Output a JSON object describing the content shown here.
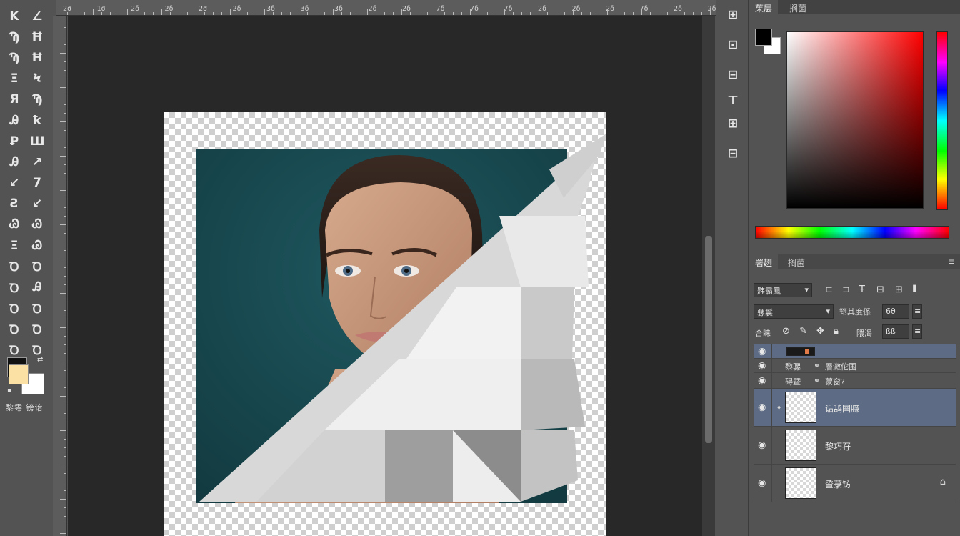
{
  "toolbox": {
    "tools": [
      "K",
      "∠",
      "Ϡ",
      "Ħ",
      "Ϡ",
      "Ħ",
      "Ξ",
      "Ϟ",
      "Я",
      "Ϡ",
      "Ꭿ",
      "ꝁ",
      "Ꝑ",
      "Ш",
      "Ꭿ",
      "↗",
      "↙",
      "7",
      "Ƨ",
      "↙",
      "Ꮚ",
      "Ꮚ",
      "Ξ",
      "Ꮚ",
      "Ꝺ",
      "Ꝺ",
      "Ꝺ",
      "Ꭿ",
      "Ꝺ",
      "Ꝺ",
      "Ꝺ",
      "Ꝺ",
      "Ꝺ",
      "Ꝺ"
    ],
    "footer": "黎雩 镑诒"
  },
  "ruler": {
    "top_labels": [
      "2σ",
      "1σ",
      "2δ",
      "2δ",
      "2σ",
      "2δ",
      "3δ",
      "3δ",
      "3δ",
      "2δ",
      "2δ",
      "7δ",
      "7δ",
      "7δ",
      "2δ",
      "2δ",
      "2δ",
      "7δ",
      "2δ",
      "2δ",
      "2δ"
    ]
  },
  "side_strip": {
    "icons": [
      "⊞",
      "⊡",
      "⊟",
      "⊤",
      "⊞",
      "⊟"
    ]
  },
  "color_panel": {
    "tabs": [
      "茱层",
      "搁菌"
    ],
    "fg_color": "#000000",
    "bg_color": "#ffffff"
  },
  "layers_panel": {
    "tabs": [
      "署趔",
      "搁菌"
    ],
    "filter_kind": "韪霸鳳",
    "blend_mode": "骡鬟",
    "opacity_label": "筇其度係",
    "opacity_value": "6θ",
    "lock_label": "合睐",
    "fill_label": "隈渴",
    "fill_value": "ßß",
    "small_rows": [
      {
        "name": "黎骡",
        "extra": "層溦佗围"
      },
      {
        "name": "碍暨",
        "extra": "蒙窗?"
      }
    ],
    "layers": [
      {
        "name": "诟鸹圄臁",
        "selected": true
      },
      {
        "name": "黎巧孖",
        "selected": false
      },
      {
        "name": "巹菉钫",
        "selected": false
      }
    ]
  }
}
